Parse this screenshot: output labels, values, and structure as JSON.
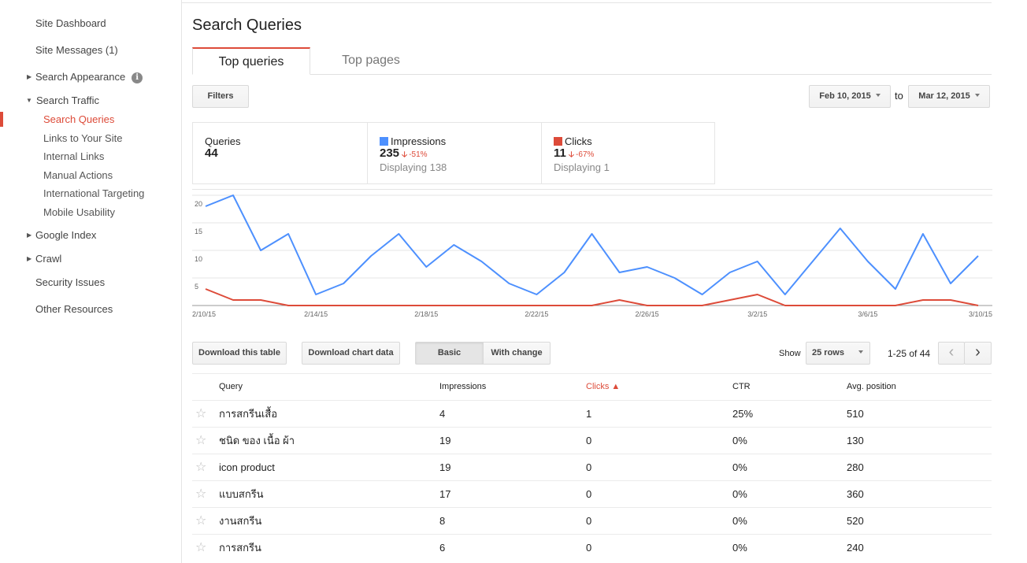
{
  "sidebar": {
    "dashboard": "Site Dashboard",
    "messages": "Site Messages (1)",
    "search_appearance": "Search Appearance",
    "search_traffic": "Search Traffic",
    "sub": [
      "Search Queries",
      "Links to Your Site",
      "Internal Links",
      "Manual Actions",
      "International Targeting",
      "Mobile Usability"
    ],
    "google_index": "Google Index",
    "crawl": "Crawl",
    "security": "Security Issues",
    "other": "Other Resources",
    "info_glyph": "i"
  },
  "page_title": "Search Queries",
  "tabs": [
    "Top queries",
    "Top pages"
  ],
  "filters_label": "Filters",
  "date_range": {
    "from": "Feb 10, 2015",
    "to_label": "to",
    "to": "Mar 12, 2015"
  },
  "stats": {
    "queries": {
      "label": "Queries",
      "value": "44"
    },
    "impressions": {
      "label": "Impressions",
      "value": "235",
      "change": "-51%",
      "sub": "Displaying 138",
      "color": "#4d90fe"
    },
    "clicks": {
      "label": "Clicks",
      "value": "11",
      "change": "-67%",
      "sub": "Displaying 1",
      "color": "#dd4b39"
    }
  },
  "chart_data": {
    "type": "line",
    "x": [
      "2/10/15",
      "2/11/15",
      "2/12/15",
      "2/13/15",
      "2/14/15",
      "2/15/15",
      "2/16/15",
      "2/17/15",
      "2/18/15",
      "2/19/15",
      "2/20/15",
      "2/21/15",
      "2/22/15",
      "2/23/15",
      "2/24/15",
      "2/25/15",
      "2/26/15",
      "2/27/15",
      "2/28/15",
      "3/1/15",
      "3/2/15",
      "3/3/15",
      "3/4/15",
      "3/5/15",
      "3/6/15",
      "3/7/15",
      "3/8/15",
      "3/9/15",
      "3/10/15"
    ],
    "x_tick_labels": [
      "2/10/15",
      "2/14/15",
      "2/18/15",
      "2/22/15",
      "2/26/15",
      "3/2/15",
      "3/6/15",
      "3/10/15"
    ],
    "y_tick_labels": [
      "5",
      "10",
      "15",
      "20"
    ],
    "ylim": [
      0,
      20
    ],
    "grid": true,
    "series": [
      {
        "name": "Impressions",
        "color": "#4d90fe",
        "values": [
          18,
          20,
          10,
          13,
          2,
          4,
          9,
          13,
          7,
          11,
          8,
          4,
          2,
          6,
          13,
          6,
          7,
          5,
          2,
          6,
          8,
          2,
          8,
          14,
          8,
          3,
          13,
          4,
          9
        ]
      },
      {
        "name": "Clicks",
        "color": "#dd4b39",
        "values": [
          3,
          1,
          1,
          0,
          0,
          0,
          0,
          0,
          0,
          0,
          0,
          0,
          0,
          0,
          0,
          1,
          0,
          0,
          0,
          1,
          2,
          0,
          0,
          0,
          0,
          0,
          1,
          1,
          0
        ]
      }
    ]
  },
  "buttons": {
    "download_table": "Download this table",
    "download_chart": "Download chart data",
    "basic": "Basic",
    "with_change": "With change"
  },
  "pagination": {
    "show_label": "Show",
    "rows_value": "25 rows",
    "range": "1-25 of 44",
    "prev_glyph": "‹",
    "next_glyph": "›"
  },
  "table": {
    "headers": {
      "query": "Query",
      "impressions": "Impressions",
      "clicks": "Clicks ▲",
      "ctr": "CTR",
      "position": "Avg. position"
    },
    "star_glyph": "☆",
    "rows": [
      {
        "query": "การสกรีนเสื้อ",
        "impressions": "4",
        "clicks": "1",
        "ctr": "25%",
        "position": "510"
      },
      {
        "query": "ชนิด ของ เนื้อ ผ้า",
        "impressions": "19",
        "clicks": "0",
        "ctr": "0%",
        "position": "130"
      },
      {
        "query": "icon product",
        "impressions": "19",
        "clicks": "0",
        "ctr": "0%",
        "position": "280"
      },
      {
        "query": "แบบสกรีน",
        "impressions": "17",
        "clicks": "0",
        "ctr": "0%",
        "position": "360"
      },
      {
        "query": "งานสกรีน",
        "impressions": "8",
        "clicks": "0",
        "ctr": "0%",
        "position": "520"
      },
      {
        "query": "การสกรีน",
        "impressions": "6",
        "clicks": "0",
        "ctr": "0%",
        "position": "240"
      }
    ]
  }
}
